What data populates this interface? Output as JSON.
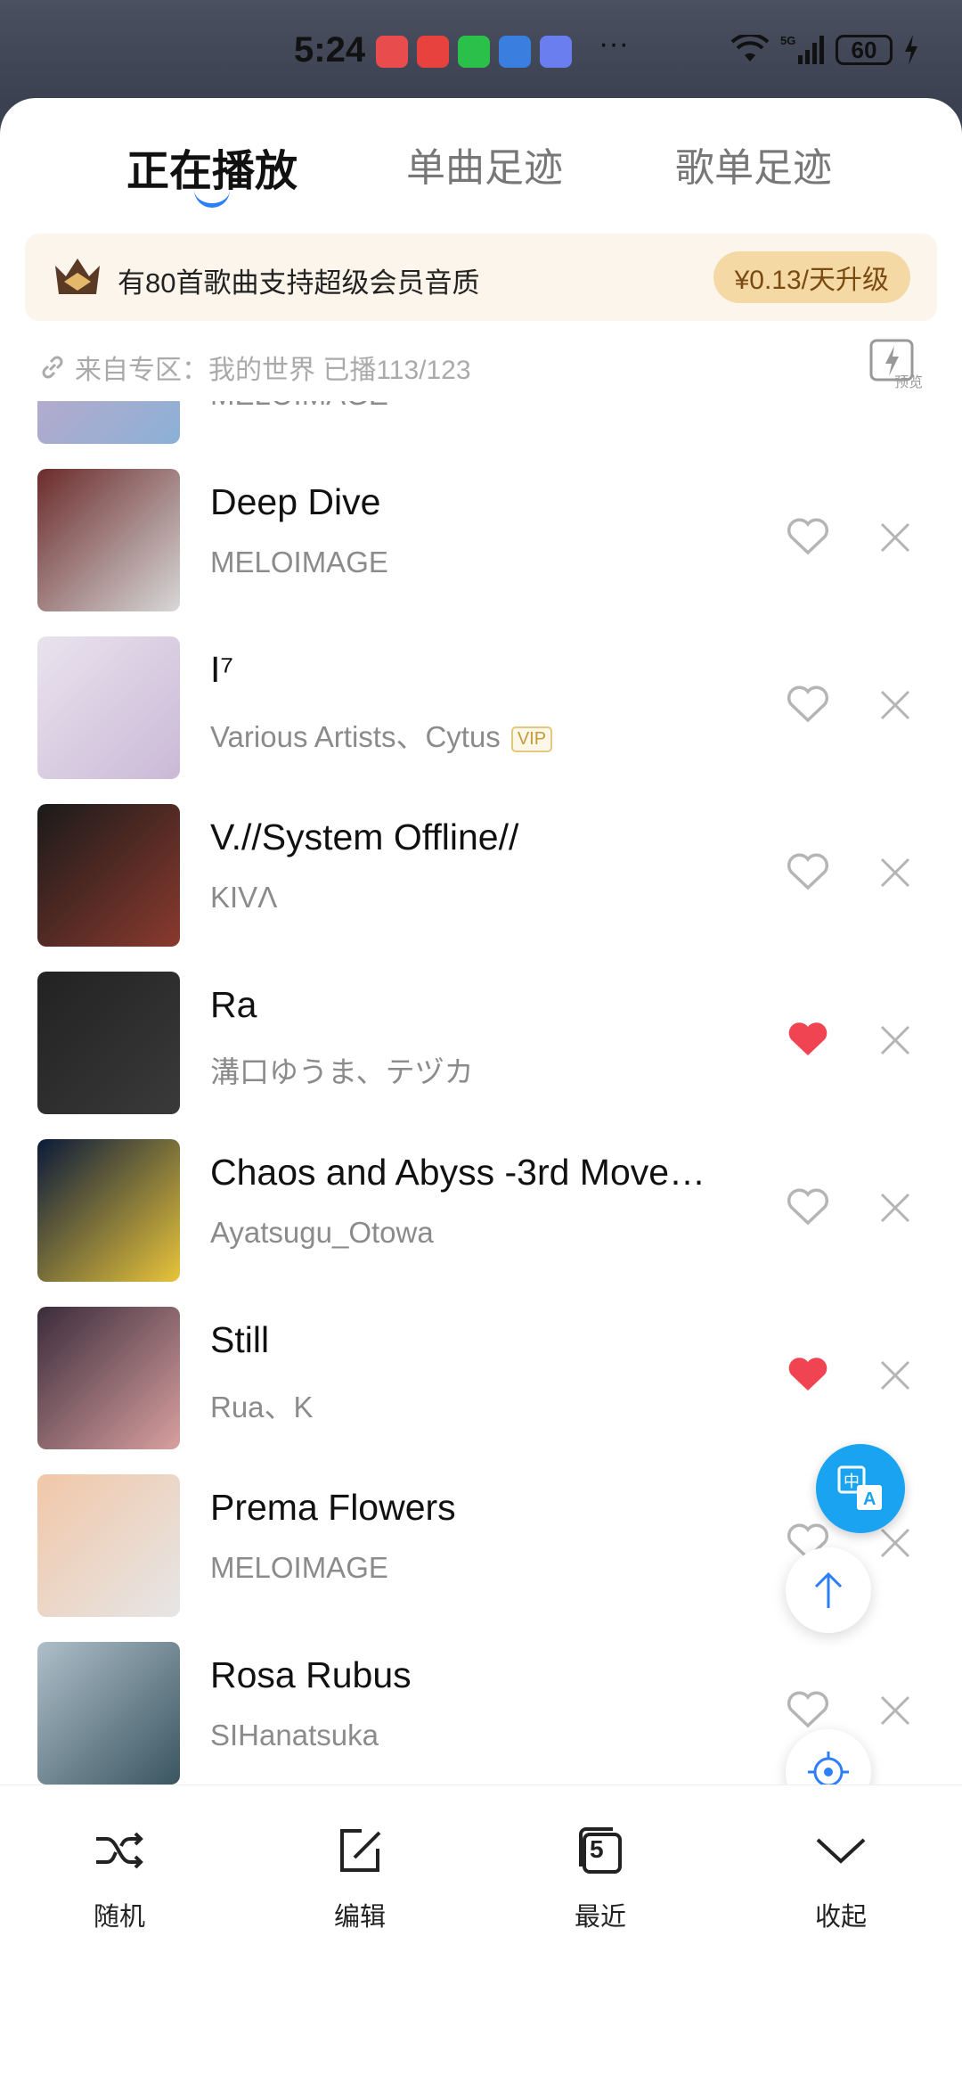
{
  "status_bar": {
    "time": "5:24",
    "battery": "60",
    "network": "5G"
  },
  "tabs": [
    {
      "label": "正在播放",
      "active": true
    },
    {
      "label": "单曲足迹",
      "active": false
    },
    {
      "label": "歌单足迹",
      "active": false
    }
  ],
  "banner": {
    "text": "有80首歌曲支持超级会员音质",
    "button": "¥0.13/天升级"
  },
  "source": {
    "text": "来自专区：我的世界  已播113/123",
    "preview_label": "预览"
  },
  "songs": [
    {
      "title": "",
      "artist": "MELOIMAGE",
      "liked": true,
      "vip": false,
      "cover_colors": [
        "#c9a9c8",
        "#8bb0d6"
      ]
    },
    {
      "title": "Deep Dive",
      "artist": "MELOIMAGE",
      "liked": false,
      "vip": false,
      "cover_colors": [
        "#6b2b2b",
        "#d8d8d8"
      ]
    },
    {
      "title": "I⁷",
      "artist": "Various Artists、Cytus",
      "liked": false,
      "vip": true,
      "vip_label": "VIP",
      "cover_colors": [
        "#e9e3ee",
        "#cbb9d6"
      ]
    },
    {
      "title": "V.//System Offline//",
      "artist": "KIVΛ",
      "liked": false,
      "vip": false,
      "cover_colors": [
        "#1a1a1a",
        "#8a3a2e"
      ]
    },
    {
      "title": "Ra",
      "artist": "溝口ゆうま、テヅカ",
      "liked": true,
      "vip": false,
      "cover_colors": [
        "#222222",
        "#3a3a3a"
      ]
    },
    {
      "title": "Chaos and Abyss -3rd Move…",
      "artist": "Ayatsugu_Otowa",
      "liked": false,
      "vip": false,
      "cover_colors": [
        "#0a1a3a",
        "#e8c43a"
      ]
    },
    {
      "title": "Still",
      "artist": "Rua、K",
      "liked": true,
      "vip": false,
      "cover_colors": [
        "#3a2c3a",
        "#d9a0a0"
      ]
    },
    {
      "title": "Prema Flowers",
      "artist": "MELOIMAGE",
      "liked": false,
      "vip": false,
      "cover_colors": [
        "#f1c7a8",
        "#e6e6e6"
      ]
    },
    {
      "title": "Rosa Rubus",
      "artist": "SIHanatsuka",
      "liked": false,
      "vip": false,
      "cover_colors": [
        "#aebfc9",
        "#3a5560"
      ]
    }
  ],
  "bottom_bar": [
    {
      "label": "随机",
      "icon": "shuffle-icon"
    },
    {
      "label": "编辑",
      "icon": "edit-icon"
    },
    {
      "label": "最近",
      "icon": "recent-icon",
      "badge": "5"
    },
    {
      "label": "收起",
      "icon": "collapse-icon"
    }
  ],
  "colors": {
    "accent": "#2d7ff9",
    "heart_red": "#f04452",
    "icon_gray": "#b5b5b5",
    "translate_blue": "#1aa3f0"
  }
}
